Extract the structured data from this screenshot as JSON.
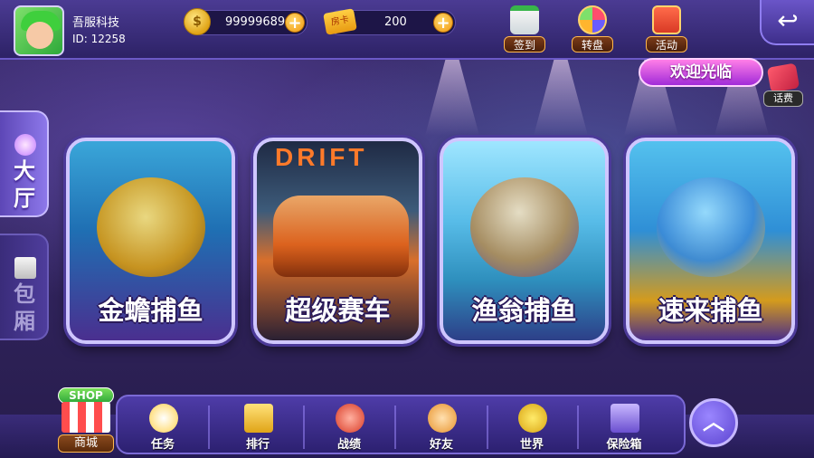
{
  "user": {
    "name": "吾服科技",
    "id": "ID: 12258"
  },
  "currency": {
    "coins": "99999689",
    "card_label": "房卡",
    "cards": "200",
    "plus": "+"
  },
  "top_nav": [
    {
      "label": "签到",
      "icon": "calendar-icon"
    },
    {
      "label": "转盘",
      "icon": "wheel-icon"
    },
    {
      "label": "活动",
      "icon": "gift-icon"
    }
  ],
  "back": "↩",
  "welcome": "欢迎光临",
  "promo": {
    "label": "话费",
    "icon": "phone-card-icon"
  },
  "side_tabs": [
    {
      "label": "大\n厅",
      "icon": "hall-icon"
    },
    {
      "label": "包\n厢",
      "icon": "cards-icon"
    }
  ],
  "games": [
    {
      "title": "金蟾捕鱼"
    },
    {
      "title": "超级赛车",
      "banner": "DRIFT"
    },
    {
      "title": "渔翁捕鱼"
    },
    {
      "title": "速来捕鱼"
    }
  ],
  "shop": {
    "badge": "SHOP",
    "label": "商城"
  },
  "bottom_nav": [
    {
      "label": "任务",
      "icon": "task-icon"
    },
    {
      "label": "排行",
      "icon": "rank-icon"
    },
    {
      "label": "战绩",
      "icon": "record-icon"
    },
    {
      "label": "好友",
      "icon": "handshake-icon"
    },
    {
      "label": "世界",
      "icon": "chat-icon"
    },
    {
      "label": "保险箱",
      "icon": "safe-icon"
    }
  ],
  "expand": "︿"
}
